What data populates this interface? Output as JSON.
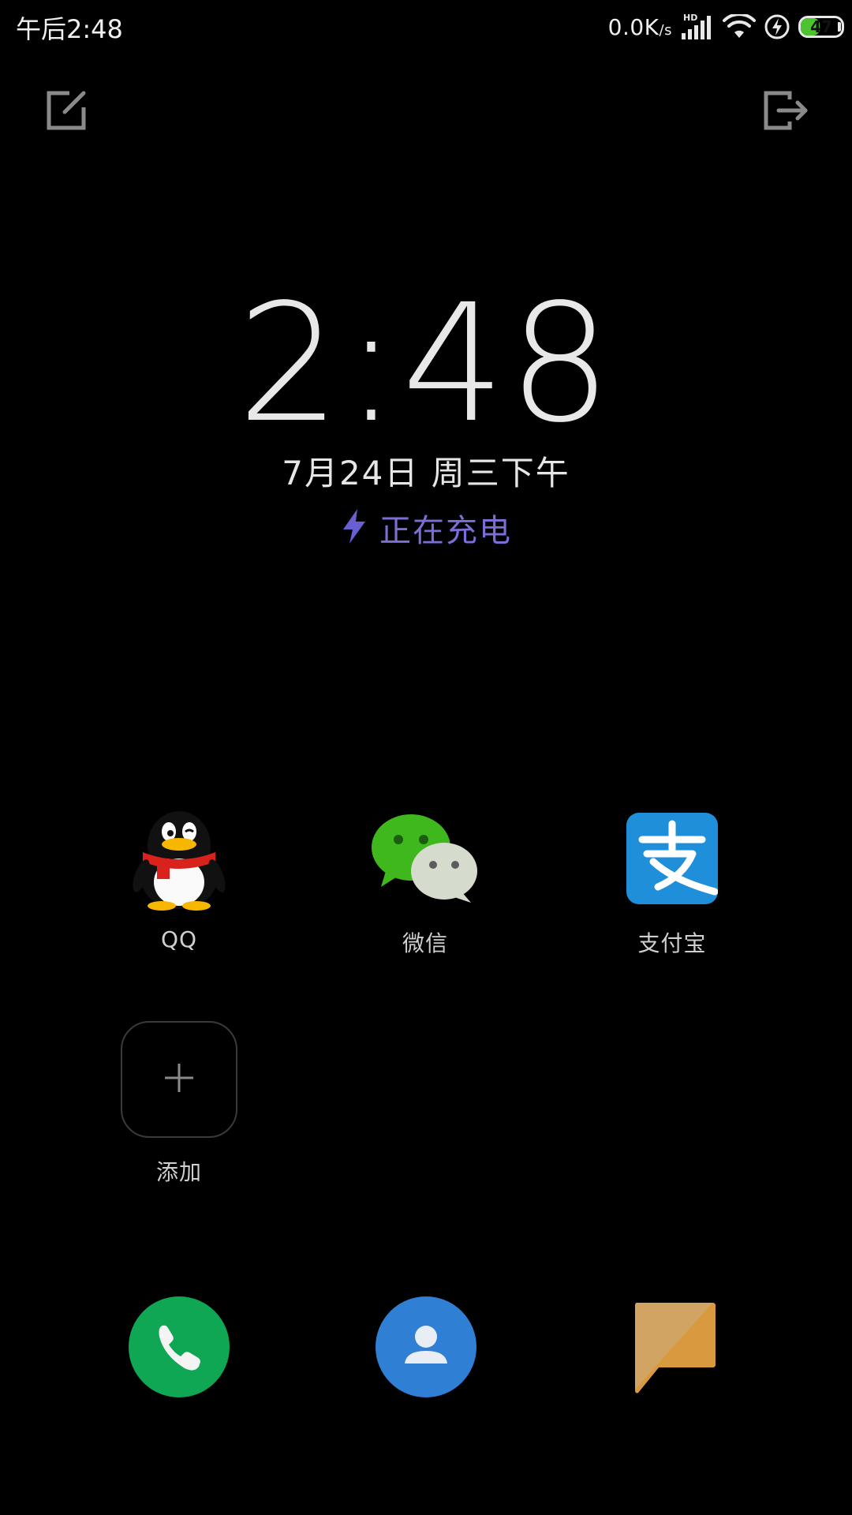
{
  "status_bar": {
    "time": "午后2:48",
    "net_speed_value": "0.0K",
    "net_speed_unit": "/s",
    "network_badge": "HD",
    "battery_level": "47",
    "battery_fraction": 0.47,
    "icons": [
      "signal-icon",
      "wifi-icon",
      "charging-bolt-icon",
      "battery-icon"
    ]
  },
  "top_actions": {
    "left_icon": "edit-note-icon",
    "right_icon": "exit-icon"
  },
  "clock": {
    "time": "2:48",
    "date": "7月24日 周三下午",
    "charging_status": "正在充电",
    "charging_color": "#7a6fd6"
  },
  "apps": [
    {
      "label": "QQ",
      "icon": "qq-penguin-icon"
    },
    {
      "label": "微信",
      "icon": "wechat-icon",
      "color": "#2dc100"
    },
    {
      "label": "支付宝",
      "icon": "alipay-icon",
      "color": "#1e8fd8"
    },
    {
      "label": "添加",
      "icon": "add-plus-icon"
    }
  ],
  "dock": [
    {
      "name": "phone",
      "icon": "phone-icon",
      "color": "#0fa654"
    },
    {
      "name": "contacts",
      "icon": "contacts-icon",
      "color": "#2f7fd4"
    },
    {
      "name": "messages",
      "icon": "messages-icon",
      "color": "#d9a04a"
    }
  ]
}
